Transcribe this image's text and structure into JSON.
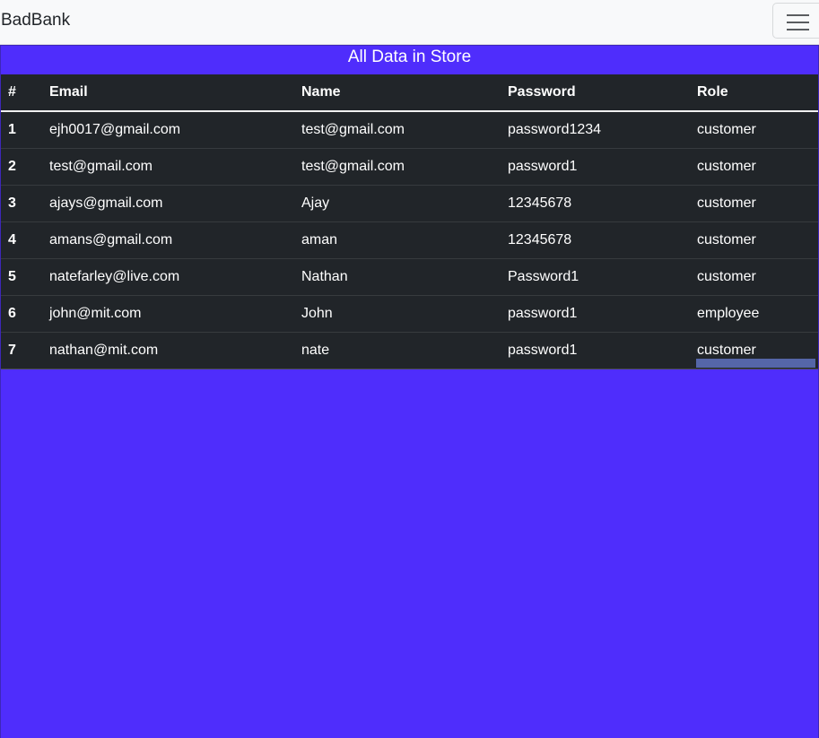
{
  "navbar": {
    "brand": "BadBank",
    "toggler_icon": "hamburger-menu-icon"
  },
  "card": {
    "header": "All Data in Store"
  },
  "table": {
    "columns": [
      "#",
      "Email",
      "Name",
      "Password",
      "Role"
    ],
    "rows": [
      {
        "num": "1",
        "email": "ejh0017@gmail.com",
        "name": "test@gmail.com",
        "password": "password1234",
        "role": "customer"
      },
      {
        "num": "2",
        "email": "test@gmail.com",
        "name": "test@gmail.com",
        "password": "password1",
        "role": "customer"
      },
      {
        "num": "3",
        "email": "ajays@gmail.com",
        "name": "Ajay",
        "password": "12345678",
        "role": "customer"
      },
      {
        "num": "4",
        "email": "amans@gmail.com",
        "name": "aman",
        "password": "12345678",
        "role": "customer"
      },
      {
        "num": "5",
        "email": "natefarley@live.com",
        "name": "Nathan",
        "password": "Password1",
        "role": "customer"
      },
      {
        "num": "6",
        "email": "john@mit.com",
        "name": "John",
        "password": "password1",
        "role": "employee"
      },
      {
        "num": "7",
        "email": "nathan@mit.com",
        "name": "nate",
        "password": "password1",
        "role": "customer"
      }
    ]
  },
  "colors": {
    "page_background": "#4f2dfc",
    "table_background": "#212529",
    "navbar_background": "#f8f9fa"
  }
}
